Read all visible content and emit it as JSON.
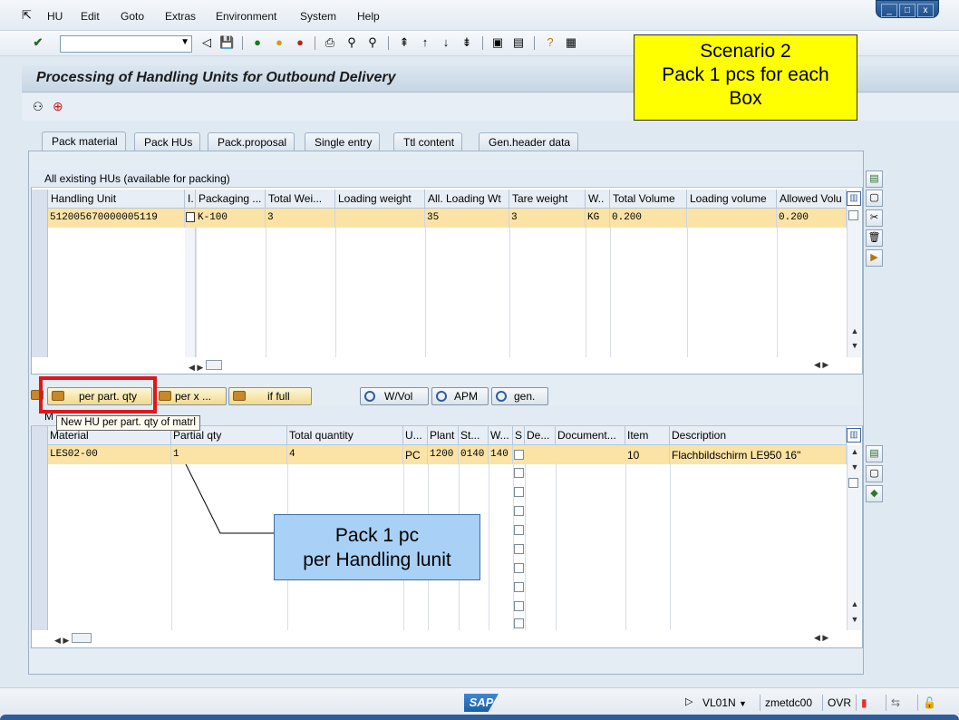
{
  "menu": {
    "items": [
      "HU",
      "Edit",
      "Goto",
      "Extras",
      "Environment",
      "System",
      "Help"
    ]
  },
  "window_controls": {
    "minimize": "_",
    "restore": "□",
    "close": "x"
  },
  "page_title": "Processing of Handling Units for Outbound Delivery",
  "tabs": [
    "Pack material",
    "Pack HUs",
    "Pack.proposal",
    "Single entry",
    "Ttl content",
    "Gen.header data"
  ],
  "hu_table": {
    "title": "All existing HUs (available for packing)",
    "columns": [
      "Handling Unit",
      "I.",
      "Packaging ...",
      "Total Wei...",
      "Loading weight",
      "All. Loading Wt",
      "Tare weight",
      "W..",
      "Total Volume",
      "Loading volume",
      "Allowed Volu"
    ],
    "rows": [
      {
        "handling_unit": "512005670000005119",
        "packaging": "K-100",
        "total_weight": "3",
        "loading_weight": "",
        "allowed_loading_wt": "35",
        "tare_weight": "3",
        "weight_unit": "KG",
        "total_volume": "0.200",
        "loading_volume": "",
        "allowed_volume": "0.200"
      }
    ]
  },
  "buttons": {
    "per_part_qty": "per part. qty",
    "per_x": "per x ...",
    "if_full": "if full",
    "w_vol": "W/Vol",
    "apm": "APM",
    "gen": "gen."
  },
  "tooltip": "New HU per part. qty of matrl",
  "material_table": {
    "title_partial": "M",
    "columns": [
      "Material",
      "Partial qty",
      "Total quantity",
      "U...",
      "Plant",
      "St...",
      "W...",
      "S",
      "De...",
      "Document...",
      "Item",
      "Description"
    ],
    "rows": [
      {
        "material": "LES02-00",
        "partial_qty": "1",
        "total_quantity": "4",
        "unit": "PC",
        "plant": "1200",
        "storage_loc": "0140",
        "warehouse": "140",
        "item": "10",
        "description": "Flachbildschirm LE950 16\""
      }
    ]
  },
  "annotations": {
    "scenario_lines": [
      "Scenario 2",
      "Pack 1 pcs for each",
      "Box"
    ],
    "note_lines": [
      "Pack 1 pc",
      "per Handling lunit"
    ]
  },
  "status_bar": {
    "logo": "SAP",
    "transaction": "VL01N",
    "server": "zmetdc00",
    "mode": "OVR"
  },
  "colors": {
    "highlight_row": "#fbe3a6",
    "annotation_yellow": "#ffff00",
    "annotation_blue": "#a9d0f5",
    "red_outline": "#e0161b"
  }
}
